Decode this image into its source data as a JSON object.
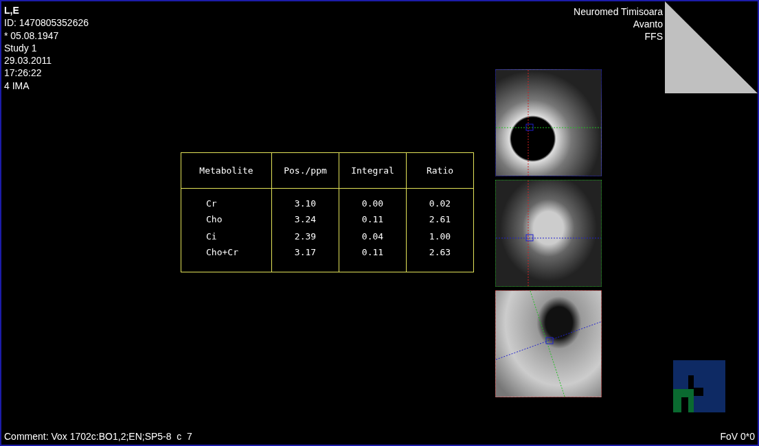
{
  "patient_info": {
    "name": "L,E",
    "lines": [
      "ID: 1470805352626",
      "* 05.08.1947",
      "Study 1",
      "29.03.2011",
      "17:26:22",
      "4 IMA"
    ]
  },
  "site_info": [
    "Neuromed Timisoara",
    "Avanto",
    "FFS"
  ],
  "metabolite_table": {
    "columns": [
      "Metabolite",
      "Pos./ppm",
      "Integral",
      "Ratio"
    ],
    "rows": [
      [
        "Cr",
        "3.10",
        "0.00",
        "0.02"
      ],
      [
        "Cho",
        "3.24",
        "0.11",
        "2.61"
      ],
      [
        "Ci",
        "2.39",
        "0.04",
        "1.00"
      ],
      [
        "Cho+Cr",
        "3.17",
        "0.11",
        "2.63"
      ]
    ]
  },
  "localizer_images": [
    {
      "kind": "axial",
      "color": "#2020c0"
    },
    {
      "kind": "coronal",
      "color": "#20a020"
    },
    {
      "kind": "sagittal",
      "color": "#c03030"
    }
  ],
  "comment": "Comment: Vox 1702c:BO1,2;EN;SP5-8  c  7",
  "fov": "FoV 0*0"
}
